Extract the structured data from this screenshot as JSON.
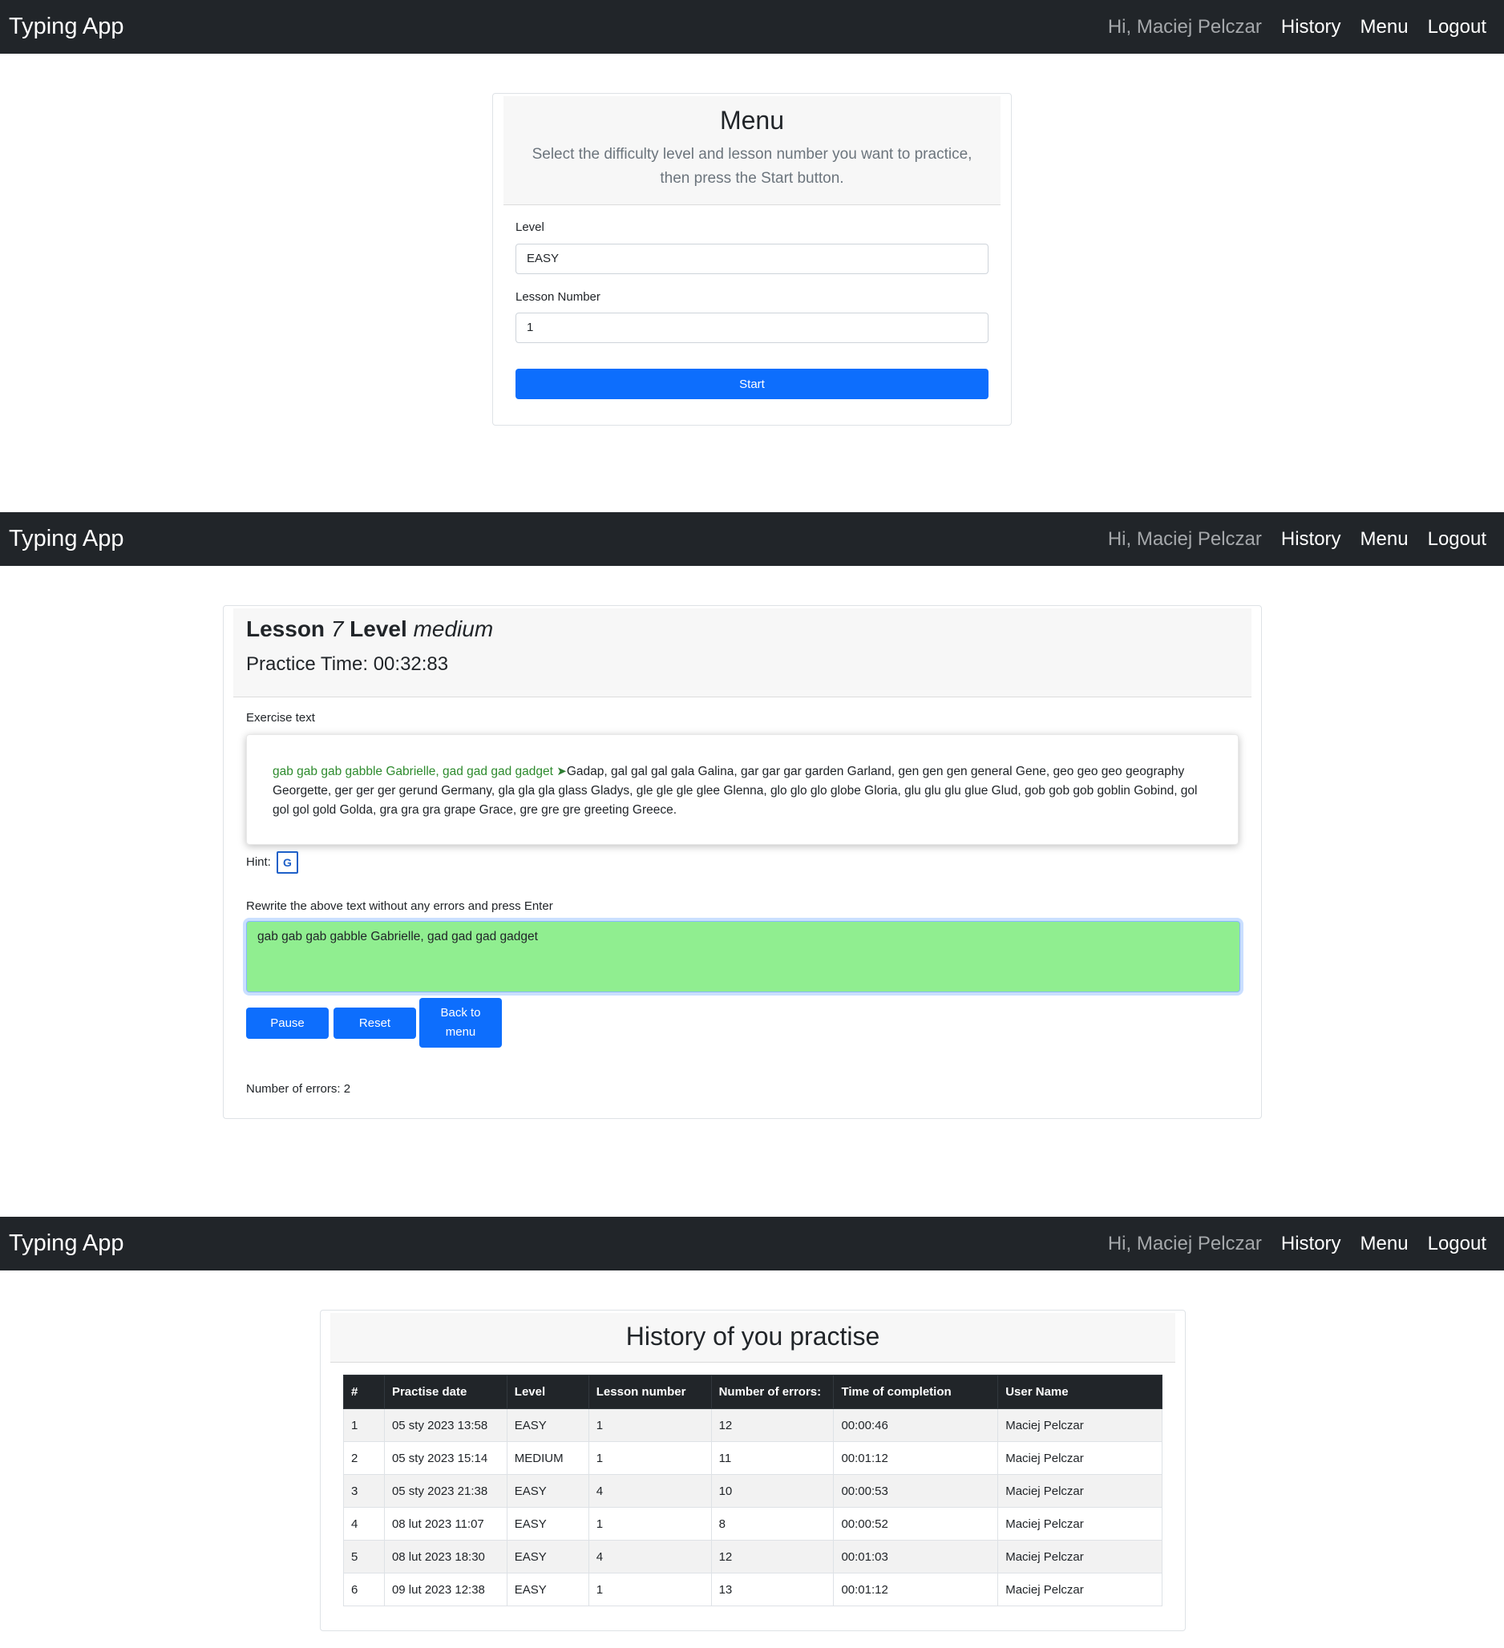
{
  "navbar": {
    "brand": "Typing App",
    "greeting": "Hi, Maciej Pelczar",
    "links": [
      "History",
      "Menu",
      "Logout"
    ]
  },
  "menu": {
    "title": "Menu",
    "description": "Select the difficulty level and lesson number you want to practice, then press the Start button.",
    "level_label": "Level",
    "level_value": "EASY",
    "lesson_label": "Lesson Number",
    "lesson_value": "1",
    "start_label": "Start"
  },
  "lesson": {
    "title_prefix": "Lesson",
    "lesson_number": "7",
    "level_word": "Level",
    "level_value": "medium",
    "practice_time": "Practice Time: 00:32:83",
    "exercise_label": "Exercise text",
    "typed_text": "gab gab gab gabble Gabrielle, gad gad gad gadget",
    "cursor_glyph": "➤",
    "remaining_text": "Gadap, gal gal gal gala Galina, gar gar gar garden Garland, gen gen gen general Gene, geo geo geo geography Georgette, ger ger ger gerund Germany, gla gla gla glass Gladys, gle gle gle glee Glenna, glo glo glo globe Gloria, glu glu glu glue Glud, gob gob gob goblin Gobind, gol gol gol gold Golda, gra gra gra grape Grace, gre gre gre greeting Greece.",
    "hint_label": "Hint:",
    "hint_key": "G",
    "rewrite_label": "Rewrite the above text without any errors and press Enter",
    "typed_value": "gab gab gab gabble Gabrielle, gad gad gad gadget",
    "pause_label": "Pause",
    "reset_label": "Reset",
    "back_label": "Back to menu",
    "errors_text": "Number of errors: 2",
    "typing_bg_color": "#90ee90"
  },
  "history": {
    "title": "History of you practise",
    "columns": [
      "#",
      "Practise date",
      "Level",
      "Lesson number",
      "Number of errors:",
      "Time of completion",
      "User Name"
    ],
    "rows": [
      [
        "1",
        "05 sty 2023 13:58",
        "EASY",
        "1",
        "12",
        "00:00:46",
        "Maciej Pelczar"
      ],
      [
        "2",
        "05 sty 2023 15:14",
        "MEDIUM",
        "1",
        "11",
        "00:01:12",
        "Maciej Pelczar"
      ],
      [
        "3",
        "05 sty 2023 21:38",
        "EASY",
        "4",
        "10",
        "00:00:53",
        "Maciej Pelczar"
      ],
      [
        "4",
        "08 lut 2023 11:07",
        "EASY",
        "1",
        "8",
        "00:00:52",
        "Maciej Pelczar"
      ],
      [
        "5",
        "08 lut 2023 18:30",
        "EASY",
        "4",
        "12",
        "00:01:03",
        "Maciej Pelczar"
      ],
      [
        "6",
        "09 lut 2023 12:38",
        "EASY",
        "1",
        "13",
        "00:01:12",
        "Maciej Pelczar"
      ]
    ]
  },
  "colors": {
    "navbar_bg": "#212529",
    "primary": "#0d6efd",
    "typed_green": "#2e8b2e"
  }
}
